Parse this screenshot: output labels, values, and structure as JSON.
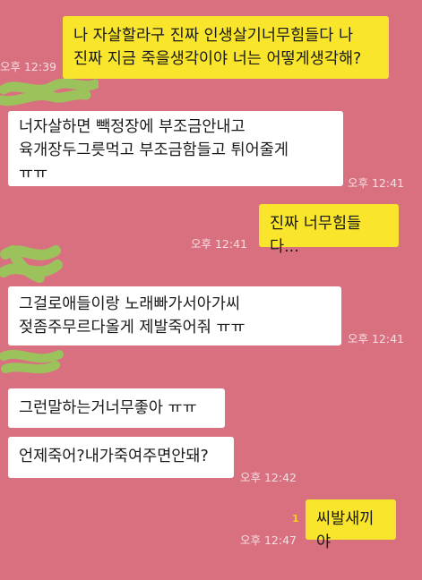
{
  "colors": {
    "background": "#d9707f",
    "outgoing_bubble": "#f9e52c",
    "incoming_bubble": "#ffffff",
    "timestamp": "#f6dfe3",
    "redaction": "#9cc25c",
    "unread": "#f5d020"
  },
  "messages": [
    {
      "id": "m1",
      "side": "out",
      "text": "나 자살할라구 진짜 인생살기너무힘들다 나\n진짜 지금 죽을생각이야 너는 어떻게생각해?",
      "time": "오후 12:39"
    },
    {
      "id": "m2",
      "side": "in",
      "text": "너자살하면 빽정장에 부조금안내고\n육개장두그릇먹고 부조금함들고 튀어줄게\nㅠㅠ",
      "time": "오후 12:41"
    },
    {
      "id": "m3",
      "side": "out",
      "text": "진짜 너무힘들다...",
      "time": "오후 12:41"
    },
    {
      "id": "m4",
      "side": "in",
      "text": "그걸로애들이랑 노래빠가서아가씨\n젖좀주무르다올게 제발죽어줘 ㅠㅠ",
      "time": "오후 12:41"
    },
    {
      "id": "m5",
      "side": "in",
      "text": "그런말하는거너무좋아 ㅠㅠ",
      "time": ""
    },
    {
      "id": "m6",
      "side": "in",
      "text": "언제죽어?내가죽여주면안돼?",
      "time": "오후 12:42"
    },
    {
      "id": "m7",
      "side": "out",
      "text": "씨발새끼야",
      "time": "오후 12:47",
      "unread": "1"
    }
  ],
  "redaction_icon": "scribble-redaction"
}
